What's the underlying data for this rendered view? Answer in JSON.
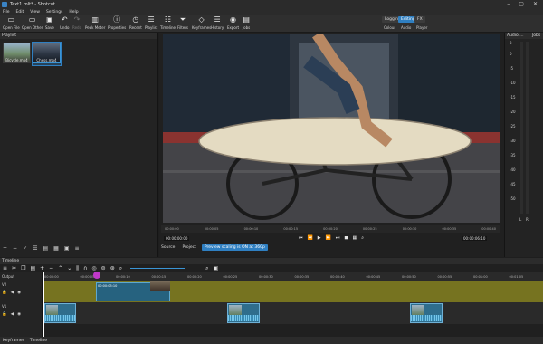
{
  "window": {
    "title": "Text1.mlt* - Shotcut"
  },
  "menu": [
    "File",
    "Edit",
    "View",
    "Settings",
    "Help"
  ],
  "toolbar": {
    "buttons": [
      {
        "label": "Open File",
        "icon": "folder-open-icon"
      },
      {
        "label": "Open Other",
        "icon": "open-other-icon"
      },
      {
        "label": "Save",
        "icon": "save-icon"
      },
      {
        "label": "Undo",
        "icon": "undo-icon"
      },
      {
        "label": "Redo",
        "icon": "redo-icon"
      },
      {
        "label": "Peak Meter",
        "icon": "peak-meter-icon"
      },
      {
        "label": "Properties",
        "icon": "properties-icon"
      },
      {
        "label": "Recent",
        "icon": "recent-icon"
      },
      {
        "label": "Playlist",
        "icon": "playlist-icon"
      },
      {
        "label": "Timeline",
        "icon": "timeline-icon"
      },
      {
        "label": "Filters",
        "icon": "filter-icon"
      },
      {
        "label": "Keyframes",
        "icon": "keyframes-icon"
      },
      {
        "label": "History",
        "icon": "history-icon"
      },
      {
        "label": "Export",
        "icon": "export-icon"
      },
      {
        "label": "Jobs",
        "icon": "jobs-icon"
      }
    ],
    "layouts": [
      "Logging",
      "Editing",
      "FX"
    ],
    "layout_active": "Editing",
    "layout_sub": [
      "Colour",
      "Audio",
      "Player"
    ]
  },
  "playlist": {
    "title": "Playlist",
    "items": [
      {
        "label": "Bicycle.mp4"
      },
      {
        "label": "Chess.mp4"
      }
    ]
  },
  "viewer": {
    "timecode_left": "00:00:00:00",
    "timecode_right": "00:00:06:10",
    "ruler": [
      "00:00:00",
      "00:00:05",
      "00:00:10",
      "00:00:15",
      "00:00:20",
      "00:00:25",
      "00:00:30",
      "00:00:35",
      "00:00:40"
    ],
    "tabs": [
      "Source",
      "Project"
    ],
    "preview_chip": "Preview scaling is ON at 360p"
  },
  "audio": {
    "title": "Audio ...",
    "jobs_title": "Jobs",
    "scale": [
      "3",
      "0",
      "-5",
      "-10",
      "-15",
      "-20",
      "-25",
      "-30",
      "-35",
      "-40",
      "-45",
      "-50"
    ],
    "channels": [
      "L",
      "R"
    ]
  },
  "timeline": {
    "title": "Timeline",
    "ruler": [
      "00:00:00",
      "00:00:05",
      "00:00:10",
      "00:00:15",
      "00:00:20",
      "00:00:25",
      "00:00:30",
      "00:00:35",
      "00:00:40",
      "00:00:45",
      "00:00:50",
      "00:00:55",
      "00:01:00",
      "00:01:05"
    ],
    "tracks": [
      {
        "name": "Output"
      },
      {
        "name": "V2"
      },
      {
        "name": "V1"
      }
    ],
    "v2_clip_label": "00:00:05:10"
  },
  "bottom_tabs": [
    "Keyframes",
    "Timeline"
  ],
  "colors": {
    "accent": "#2f7fc1",
    "track_v2": "#767320",
    "playhead_knob": "#c038c8"
  }
}
